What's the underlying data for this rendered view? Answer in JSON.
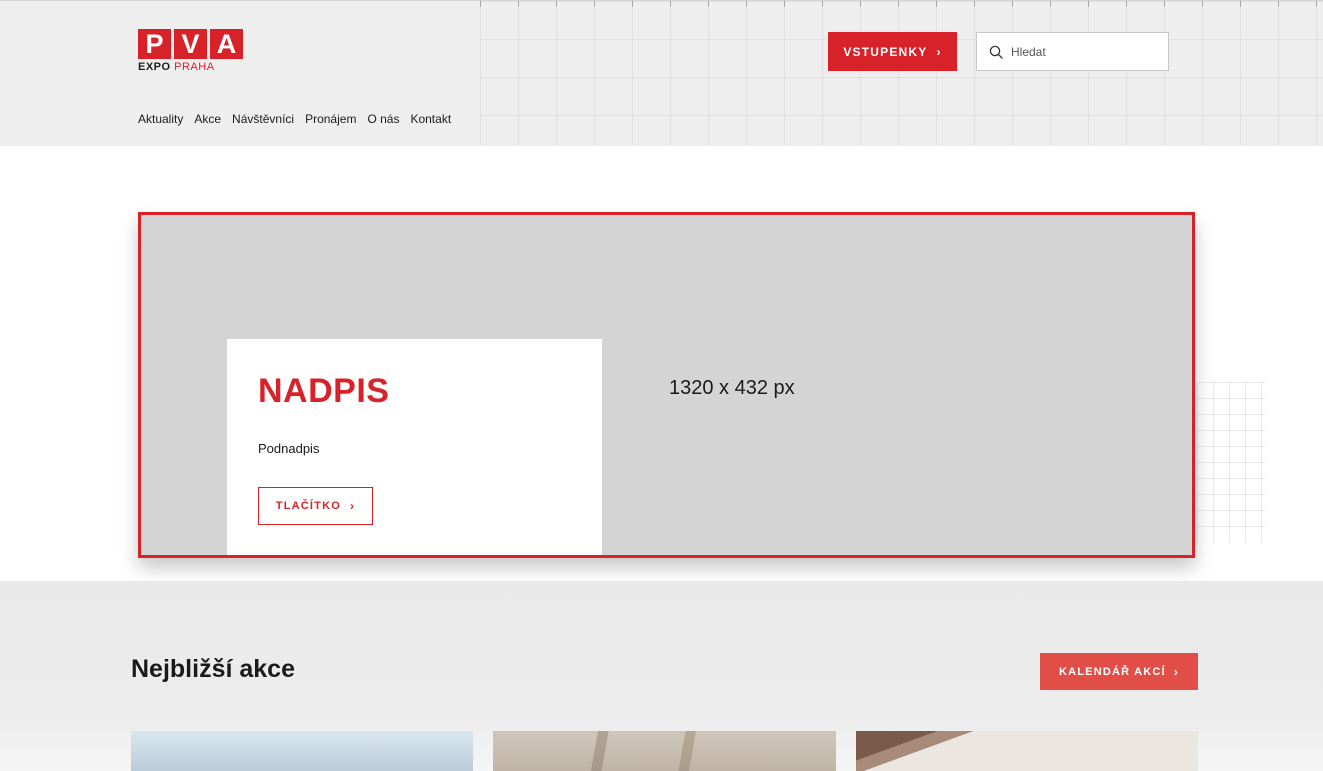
{
  "header": {
    "logo": {
      "letters": [
        "P",
        "V",
        "A"
      ],
      "sub_primary": "EXPO",
      "sub_secondary": "PRAHA",
      "brand_color": "#d8222a"
    },
    "tickets_button": {
      "label": "VSTUPENKY",
      "arrow": "›"
    },
    "search": {
      "placeholder": "Hledat",
      "icon": "search-icon"
    },
    "nav": [
      "Aktuality",
      "Akce",
      "Návštěvníci",
      "Pronájem",
      "O nás",
      "Kontakt"
    ]
  },
  "hero": {
    "title": "NADPIS",
    "subtitle": "Podnadpis",
    "button_label": "TLAČÍTKO",
    "button_arrow": "›",
    "size_label": "1320 x 432 px",
    "outline_color": "#d8222a"
  },
  "upcoming": {
    "title": "Nejbližší akce",
    "calendar_button": {
      "label": "KALENDÁŘ AKCÍ",
      "arrow": "›"
    }
  },
  "colors": {
    "accent": "#d8222a",
    "accent_soft": "#e04e47",
    "header_bg": "#eeeeee",
    "placeholder_bg": "#d4d4d4"
  }
}
